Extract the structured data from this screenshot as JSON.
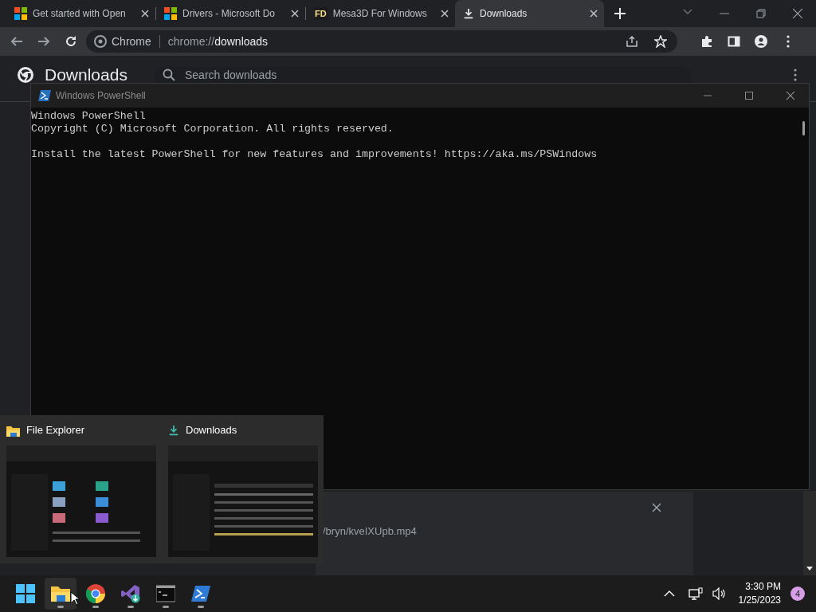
{
  "browser": {
    "tabs": [
      {
        "title": "Get started with Open",
        "kind": "microsoft",
        "selected": false
      },
      {
        "title": "Drivers - Microsoft Do",
        "kind": "microsoft",
        "selected": false
      },
      {
        "title": "Mesa3D For Windows",
        "kind": "fd",
        "favicon_text": "FD",
        "selected": false
      },
      {
        "title": "Downloads",
        "kind": "download",
        "selected": true
      }
    ],
    "omnibox": {
      "site_label": "Chrome",
      "url_scheme": "chrome://",
      "url_path": "downloads"
    }
  },
  "downloads_page": {
    "title": "Downloads",
    "search_placeholder": "Search downloads",
    "item": {
      "path": "/bryn/kveIXUpb.mp4"
    }
  },
  "powershell": {
    "title": "Windows PowerShell",
    "paragraphs": [
      [
        "Windows PowerShell",
        "Copyright (C) Microsoft Corporation. All rights reserved."
      ],
      [
        "Install the latest PowerShell for new features and improvements! https://aka.ms/PSWindows"
      ]
    ]
  },
  "taskbar_preview": {
    "windows": [
      {
        "title": "File Explorer",
        "kind": "folder"
      },
      {
        "title": "Downloads",
        "kind": "download"
      }
    ]
  },
  "taskbar": {
    "apps": [
      {
        "kind": "start",
        "selected": false,
        "running": false
      },
      {
        "kind": "explorer",
        "selected": true,
        "running": true
      },
      {
        "kind": "chrome",
        "selected": false,
        "running": true
      },
      {
        "kind": "visualstudio",
        "selected": false,
        "running": true
      },
      {
        "kind": "terminal",
        "selected": false,
        "running": true
      },
      {
        "kind": "powershell",
        "selected": false,
        "running": true
      }
    ],
    "time": "3:30 PM",
    "date": "1/25/2023",
    "notification_count": "4"
  }
}
